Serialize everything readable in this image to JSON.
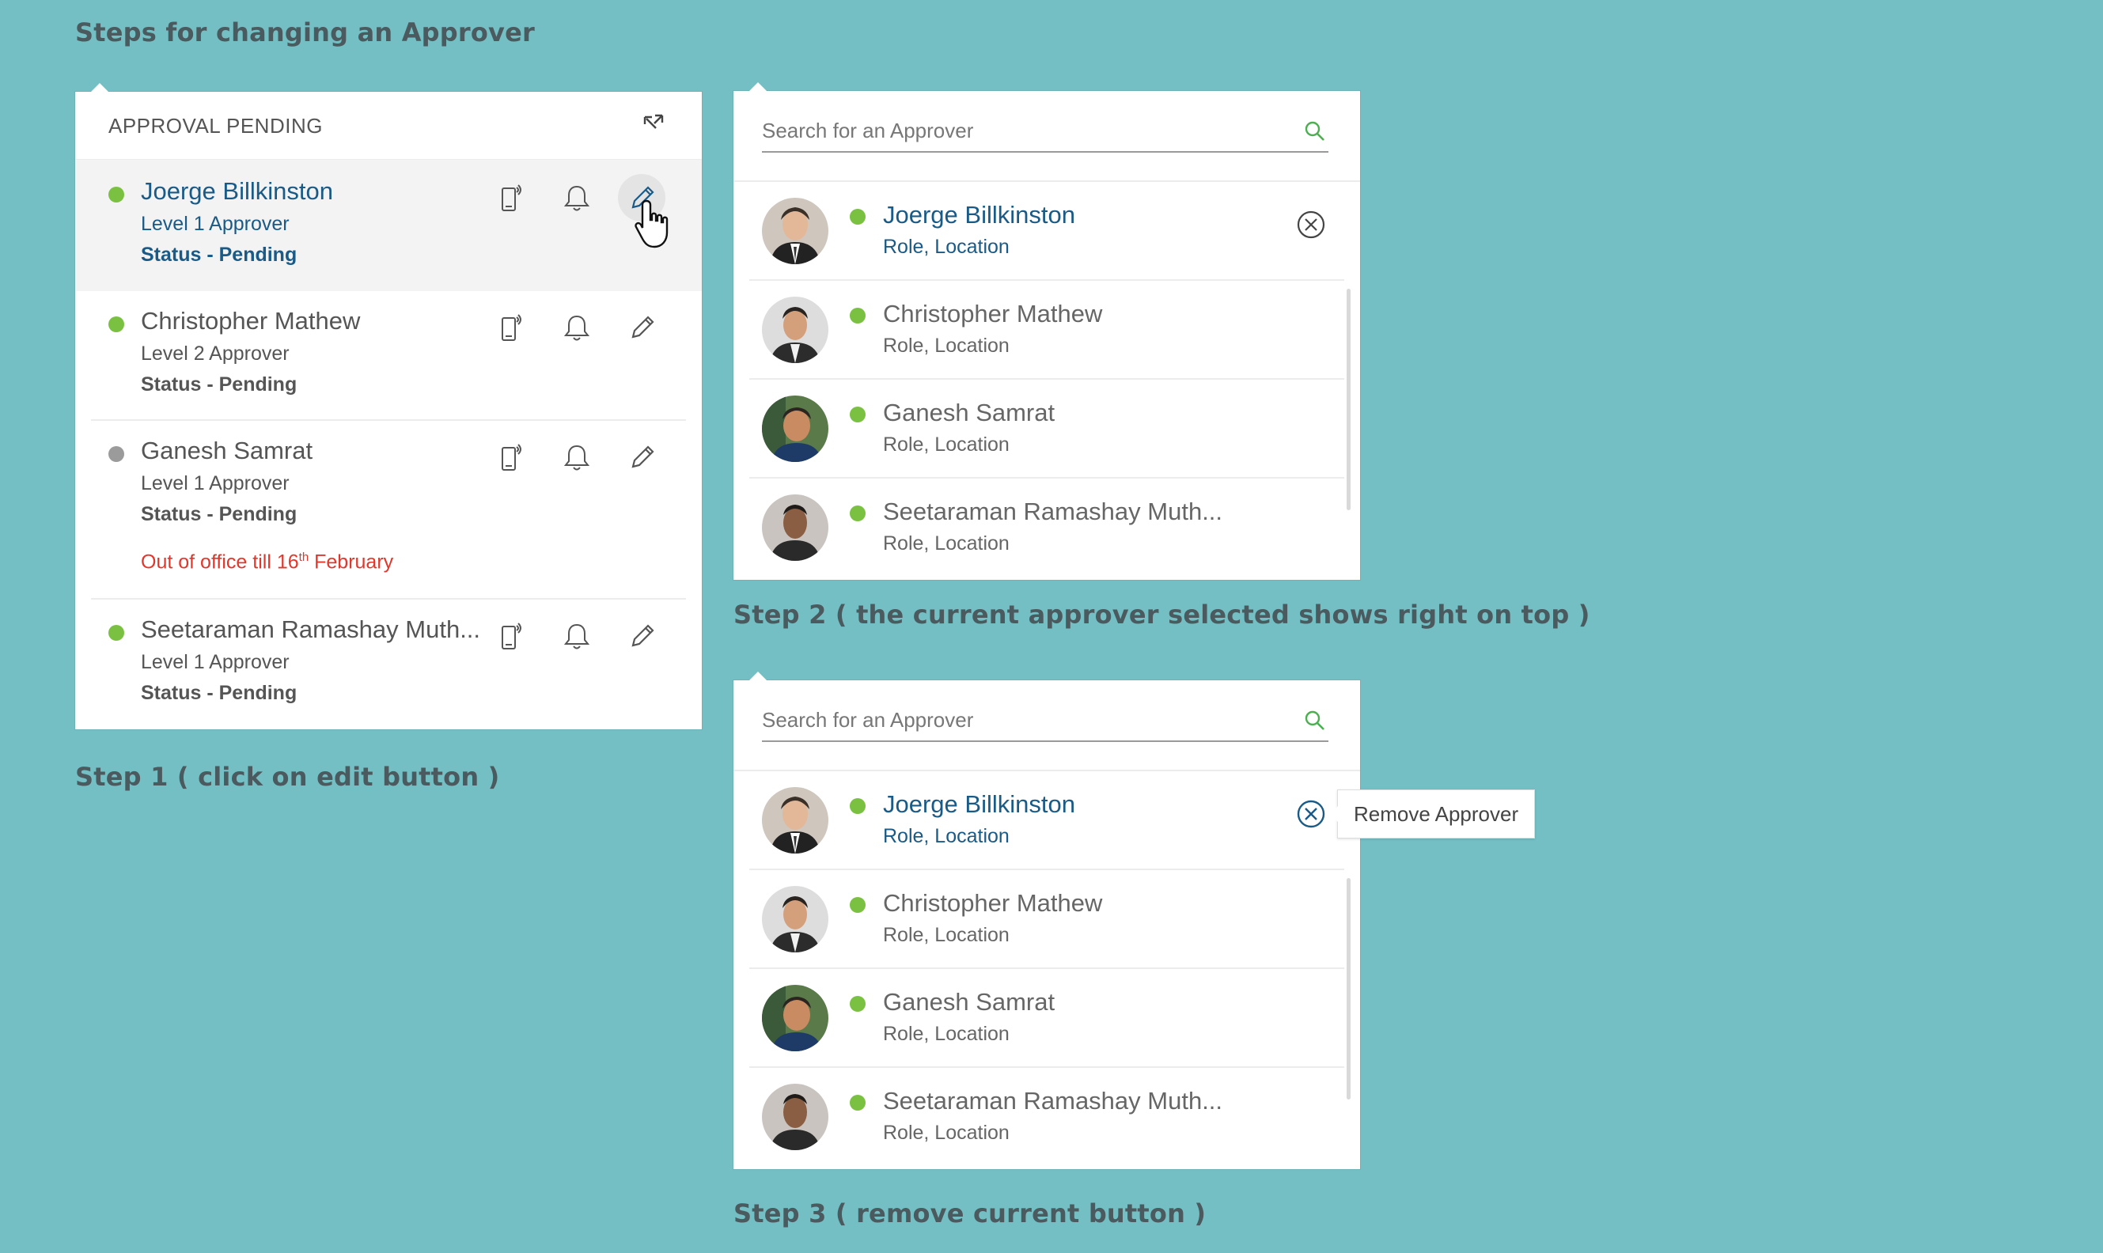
{
  "page_title": "Steps for changing an Approver",
  "step1": {
    "caption": "Step 1 ( click on edit button )",
    "card_title": "APPROVAL PENDING",
    "approvers": [
      {
        "name": "Joerge Billkinston",
        "level": "Level 1 Approver",
        "status": "Status - Pending",
        "presence_color": "#7ac142",
        "selected": true
      },
      {
        "name": "Christopher Mathew",
        "level": "Level 2 Approver",
        "status": "Status - Pending",
        "presence_color": "#7ac142"
      },
      {
        "name": "Ganesh Samrat",
        "level": "Level 1 Approver",
        "status": "Status - Pending",
        "presence_color": "#9b9b9b",
        "note_prefix": "Out of office till 16",
        "note_sup": "th",
        "note_suffix": " February"
      },
      {
        "name": "Seetaraman Ramashay Muth...",
        "level": "Level 1 Approver",
        "status": "Status - Pending",
        "presence_color": "#7ac142"
      }
    ],
    "row_icons": [
      "mobile-icon",
      "bell-icon",
      "pencil-icon"
    ]
  },
  "step2": {
    "caption": "Step 2 ( the current approver selected shows right on top )",
    "search_placeholder": "Search for an Approver",
    "results": [
      {
        "name": "Joerge Billkinston",
        "role": "Role, Location",
        "current": true
      },
      {
        "name": "Christopher Mathew",
        "role": "Role, Location"
      },
      {
        "name": "Ganesh Samrat",
        "role": "Role, Location"
      },
      {
        "name": "Seetaraman Ramashay Muth...",
        "role": "Role, Location"
      }
    ]
  },
  "step3": {
    "caption": "Step 3 ( remove current button )",
    "search_placeholder": "Search for an Approver",
    "tooltip": "Remove Approver",
    "results": [
      {
        "name": "Joerge Billkinston",
        "role": "Role, Location",
        "current": true
      },
      {
        "name": "Christopher Mathew",
        "role": "Role, Location"
      },
      {
        "name": "Ganesh Samrat",
        "role": "Role, Location"
      },
      {
        "name": "Seetaraman Ramashay Muth...",
        "role": "Role, Location"
      }
    ]
  },
  "colors": {
    "background": "#73bfc4",
    "online": "#7ac142",
    "away": "#9b9b9b",
    "link_blue": "#1a5a86",
    "alert_red": "#e0372c"
  }
}
